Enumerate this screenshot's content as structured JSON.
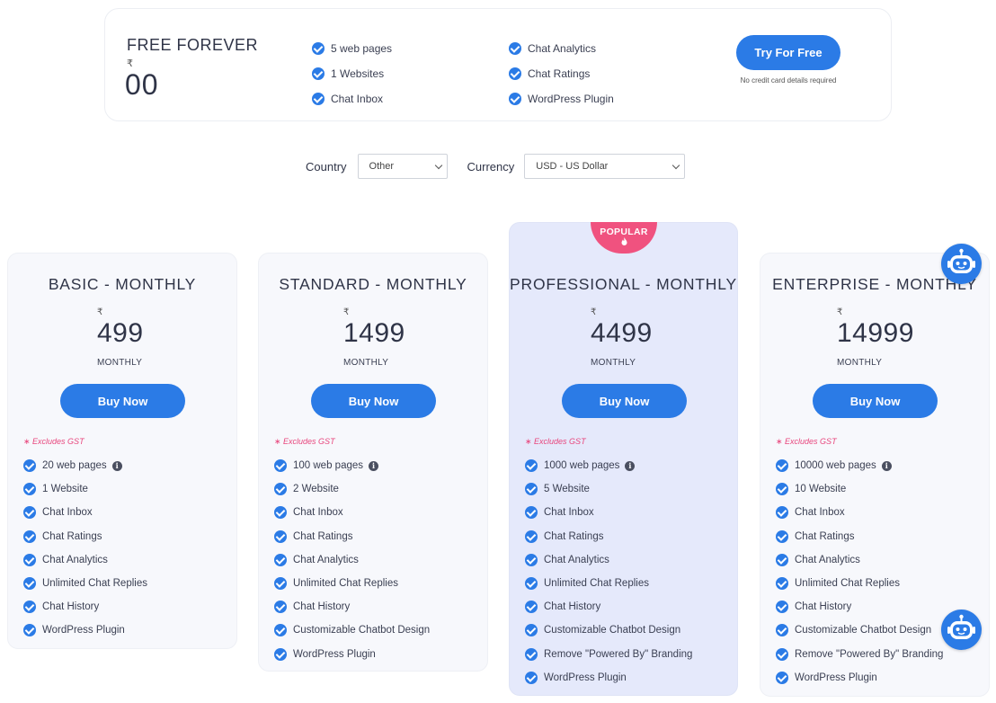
{
  "free": {
    "title": "FREE FOREVER",
    "currency_symbol": "₹",
    "price": "00",
    "features_col1": [
      "5 web pages",
      "1 Websites",
      "Chat Inbox"
    ],
    "features_col2": [
      "Chat Analytics",
      "Chat Ratings",
      "WordPress Plugin"
    ],
    "cta": "Try For Free",
    "cta_note": "No credit card details required"
  },
  "selectors": {
    "country_label": "Country",
    "country_value": "Other",
    "currency_label": "Currency",
    "currency_value": "USD - US Dollar"
  },
  "popular_badge": "POPULAR",
  "excludes_gst": "∗ Excludes GST",
  "plans": [
    {
      "name": "BASIC - MONTHLY",
      "currency_symbol": "₹",
      "price": "499",
      "period": "MONTHLY",
      "cta": "Buy Now",
      "features": [
        "20 web pages",
        "1 Website",
        "Chat Inbox",
        "Chat Ratings",
        "Chat Analytics",
        "Unlimited Chat Replies",
        "Chat History",
        "WordPress Plugin"
      ]
    },
    {
      "name": "STANDARD - MONTHLY",
      "currency_symbol": "₹",
      "price": "1499",
      "period": "MONTHLY",
      "cta": "Buy Now",
      "features": [
        "100 web pages",
        "2 Website",
        "Chat Inbox",
        "Chat Ratings",
        "Chat Analytics",
        "Unlimited Chat Replies",
        "Chat History",
        "Customizable Chatbot Design",
        "WordPress Plugin"
      ]
    },
    {
      "name": "PROFESSIONAL - MONTHLY",
      "currency_symbol": "₹",
      "price": "4499",
      "period": "MONTHLY",
      "cta": "Buy Now",
      "features": [
        "1000 web pages",
        "5 Website",
        "Chat Inbox",
        "Chat Ratings",
        "Chat Analytics",
        "Unlimited Chat Replies",
        "Chat History",
        "Customizable Chatbot Design",
        "Remove \"Powered By\" Branding",
        "WordPress Plugin"
      ]
    },
    {
      "name": "ENTERPRISE - MONTHLY",
      "currency_symbol": "₹",
      "price": "14999",
      "period": "MONTHLY",
      "cta": "Buy Now",
      "features": [
        "10000 web pages",
        "10 Website",
        "Chat Inbox",
        "Chat Ratings",
        "Chat Analytics",
        "Unlimited Chat Replies",
        "Chat History",
        "Customizable Chatbot Design",
        "Remove \"Powered By\" Branding",
        "WordPress Plugin"
      ]
    }
  ],
  "colors": {
    "accent": "#2b7be6",
    "popular": "#f0527f",
    "pro_card_bg": "#e5e9fb"
  }
}
